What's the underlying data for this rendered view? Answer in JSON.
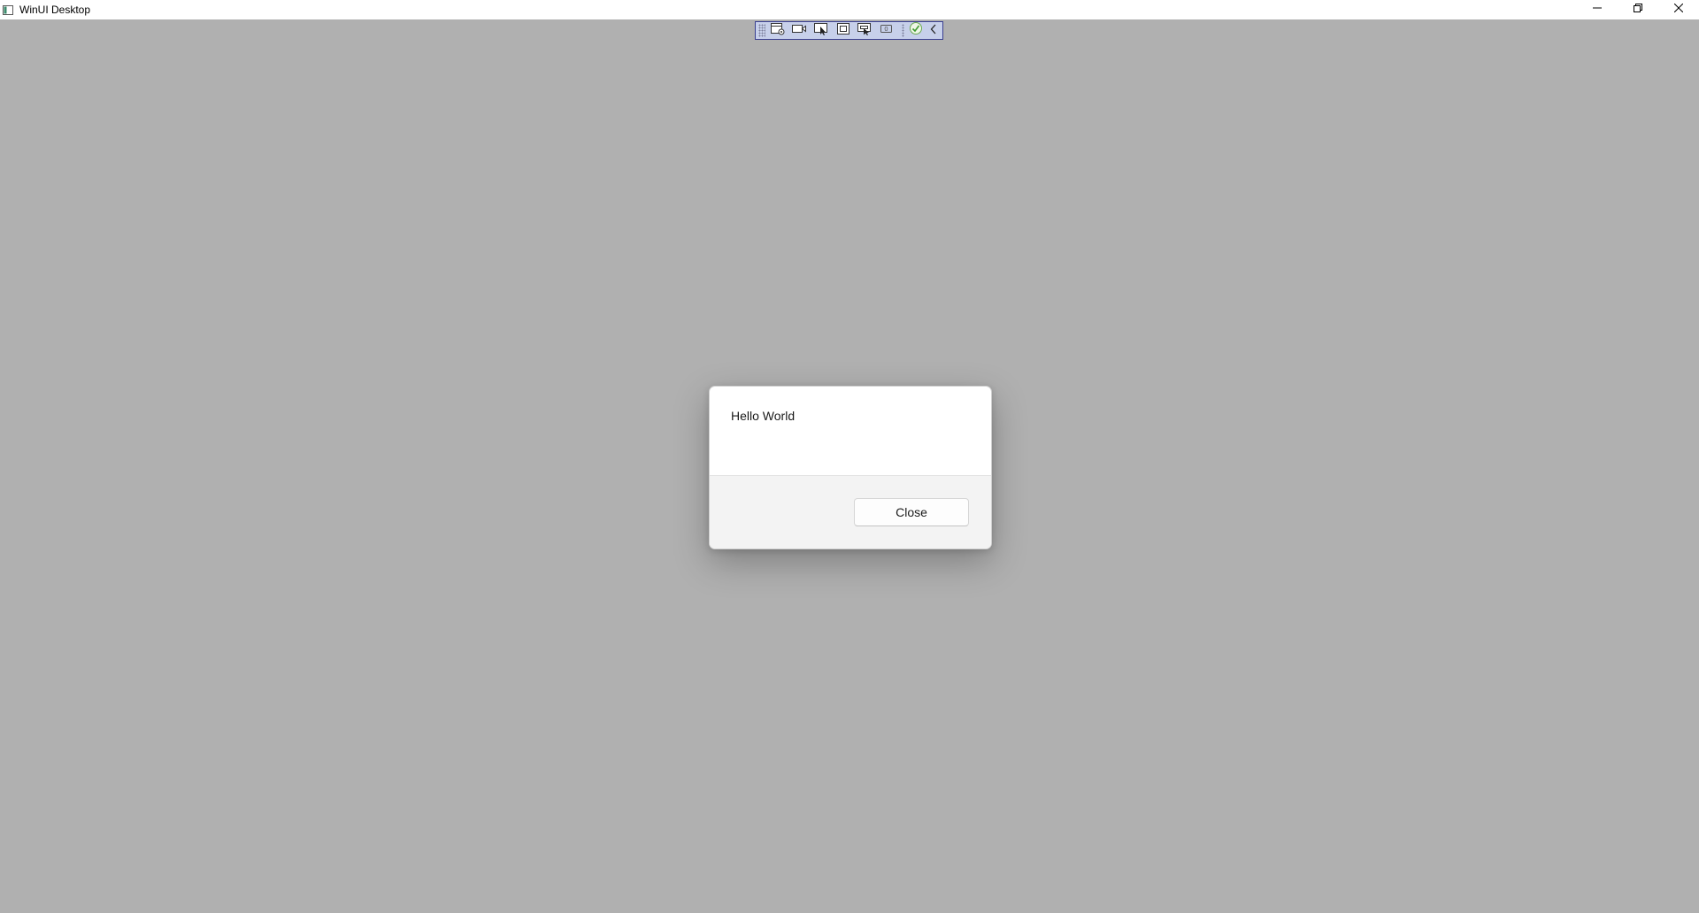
{
  "window": {
    "title": "WinUI Desktop",
    "app_icon": "app-window-icon",
    "caption_buttons": [
      "minimize-icon",
      "restore-icon",
      "close-icon"
    ]
  },
  "debug_toolbar": {
    "tools": [
      "go-to-live-visual-tree-icon",
      "record-icon",
      "select-element-icon",
      "display-layout-adorners-icon",
      "track-focus-icon",
      "binding-failures-icon",
      "hot-reload-ok-icon",
      "collapse-chevron-icon"
    ],
    "background": "#c7d0ea"
  },
  "dialog": {
    "content": "Hello World",
    "close_button_label": "Close"
  },
  "colors": {
    "backdrop": "#b0b0b0",
    "dialog_footer": "#f3f3f3"
  }
}
